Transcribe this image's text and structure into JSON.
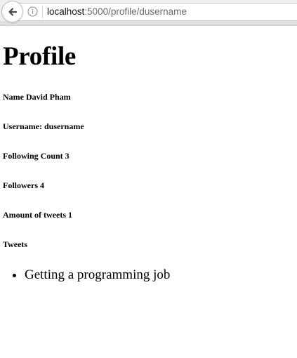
{
  "browser": {
    "url_host": "localhost",
    "url_path": ":5000/profile/dusername"
  },
  "page": {
    "title": "Profile",
    "name_label": "Name David Pham",
    "username_label": "Username: dusername",
    "following_label": "Following Count 3",
    "followers_label": "Followers 4",
    "tweet_amount_label": "Amount of tweets 1",
    "tweets_heading": "Tweets",
    "tweets": [
      "Getting a programming job"
    ]
  }
}
